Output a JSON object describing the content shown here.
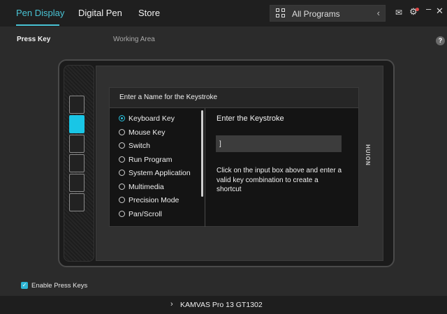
{
  "header": {
    "tabs": [
      {
        "label": "Pen Display",
        "active": true
      },
      {
        "label": "Digital Pen",
        "active": false
      },
      {
        "label": "Store",
        "active": false
      }
    ],
    "program_select": {
      "value": "All Programs",
      "icon": "grid-icon"
    },
    "icons": [
      "mail-icon",
      "gear-icon",
      "minimize-icon",
      "close-icon"
    ],
    "accent_color": "#49c3d4"
  },
  "subheader": {
    "press_key": "Press Key",
    "working_area": "Working Area",
    "help": "?"
  },
  "tablet": {
    "brand": "HUION",
    "express_keys": 6,
    "selected_key": 2
  },
  "dialog": {
    "title": "Enter a Name for the Keystroke",
    "options": [
      {
        "label": "Keyboard Key",
        "selected": true
      },
      {
        "label": "Mouse Key",
        "selected": false
      },
      {
        "label": "Switch",
        "selected": false
      },
      {
        "label": "Run Program",
        "selected": false
      },
      {
        "label": "System Application",
        "selected": false
      },
      {
        "label": "Multimedia",
        "selected": false
      },
      {
        "label": "Precision Mode",
        "selected": false
      },
      {
        "label": "Pan/Scroll",
        "selected": false
      }
    ],
    "keystroke_title": "Enter the Keystroke",
    "keystroke_value": "]",
    "help_text": "Click on the input box above and enter a valid key combination to create a shortcut"
  },
  "footer": {
    "enable_press_keys": "Enable Press Keys",
    "enable_checked": true,
    "device_name": "KAMVAS Pro 13 GT1302"
  }
}
